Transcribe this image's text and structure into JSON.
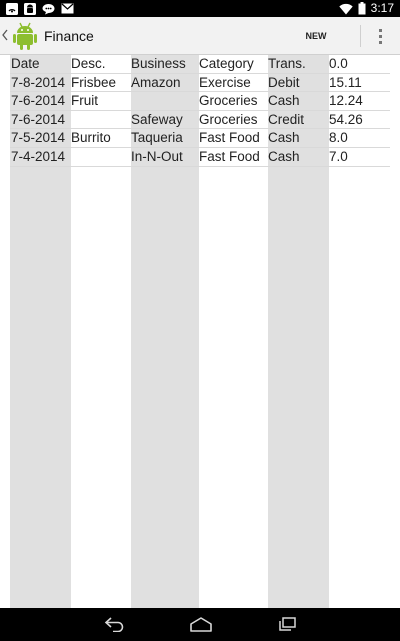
{
  "status_bar": {
    "time": "3:17",
    "left_icons": [
      "wifi-signal-icon",
      "android-icon",
      "chat-icon",
      "email-icon"
    ],
    "right_icons": [
      "wifi-icon",
      "battery-icon"
    ]
  },
  "action_bar": {
    "title": "Finance",
    "new_transaction_label": "NEW TRANSACTION",
    "overflow_icon": "overflow-menu-icon",
    "background": "#f2f2f2"
  },
  "table": {
    "headers": [
      "Date",
      "Desc.",
      "Business",
      "Category",
      "Trans.",
      "0.0"
    ],
    "rows": [
      [
        "7-8-2014",
        "Frisbee",
        "Amazon",
        "Exercise",
        "Debit",
        "15.11"
      ],
      [
        "7-6-2014",
        "Fruit",
        "",
        "Groceries",
        "Cash",
        "12.24"
      ],
      [
        "7-6-2014",
        "",
        "Safeway",
        "Groceries",
        "Credit",
        "54.26"
      ],
      [
        "7-5-2014",
        "Burrito",
        "Taqueria",
        "Fast Food",
        "Cash",
        "8.0"
      ],
      [
        "7-4-2014",
        "",
        "In-N-Out",
        "Fast Food",
        "Cash",
        "7.0"
      ]
    ],
    "stripe_color": "#e0e0e0"
  },
  "nav_bar": {
    "buttons": [
      "back-icon",
      "home-icon",
      "recent-apps-icon"
    ]
  }
}
